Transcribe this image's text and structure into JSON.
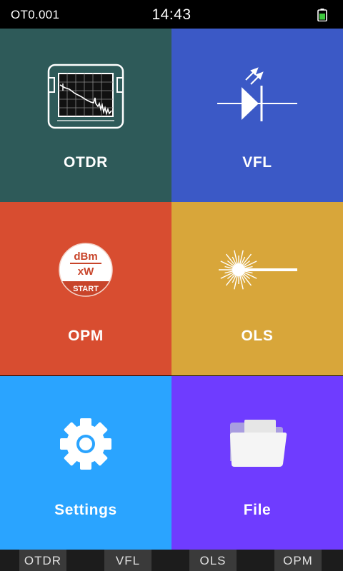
{
  "status_bar": {
    "device_id": "OT0.001",
    "time": "14:43",
    "battery_icon": "battery-icon",
    "battery_color": "#3ec93e"
  },
  "tiles": [
    {
      "label": "OTDR",
      "icon": "otdr-icon",
      "color": "#2e5a59"
    },
    {
      "label": "VFL",
      "icon": "vfl-laser-diode-icon",
      "color": "#3b59c6"
    },
    {
      "label": "OPM",
      "icon": "opm-dbm-icon",
      "color": "#d84d30"
    },
    {
      "label": "OLS",
      "icon": "ols-light-source-icon",
      "color": "#d8a63a"
    },
    {
      "label": "Settings",
      "icon": "gear-icon",
      "color": "#2aa4ff"
    },
    {
      "label": "File",
      "icon": "folder-icon",
      "color": "#6f3cff"
    }
  ],
  "opm_icon_text": {
    "top": "dBm",
    "bottom": "xW",
    "button": "START"
  },
  "tab_bar": {
    "tabs": [
      "OTDR",
      "VFL",
      "OLS",
      "OPM"
    ]
  }
}
